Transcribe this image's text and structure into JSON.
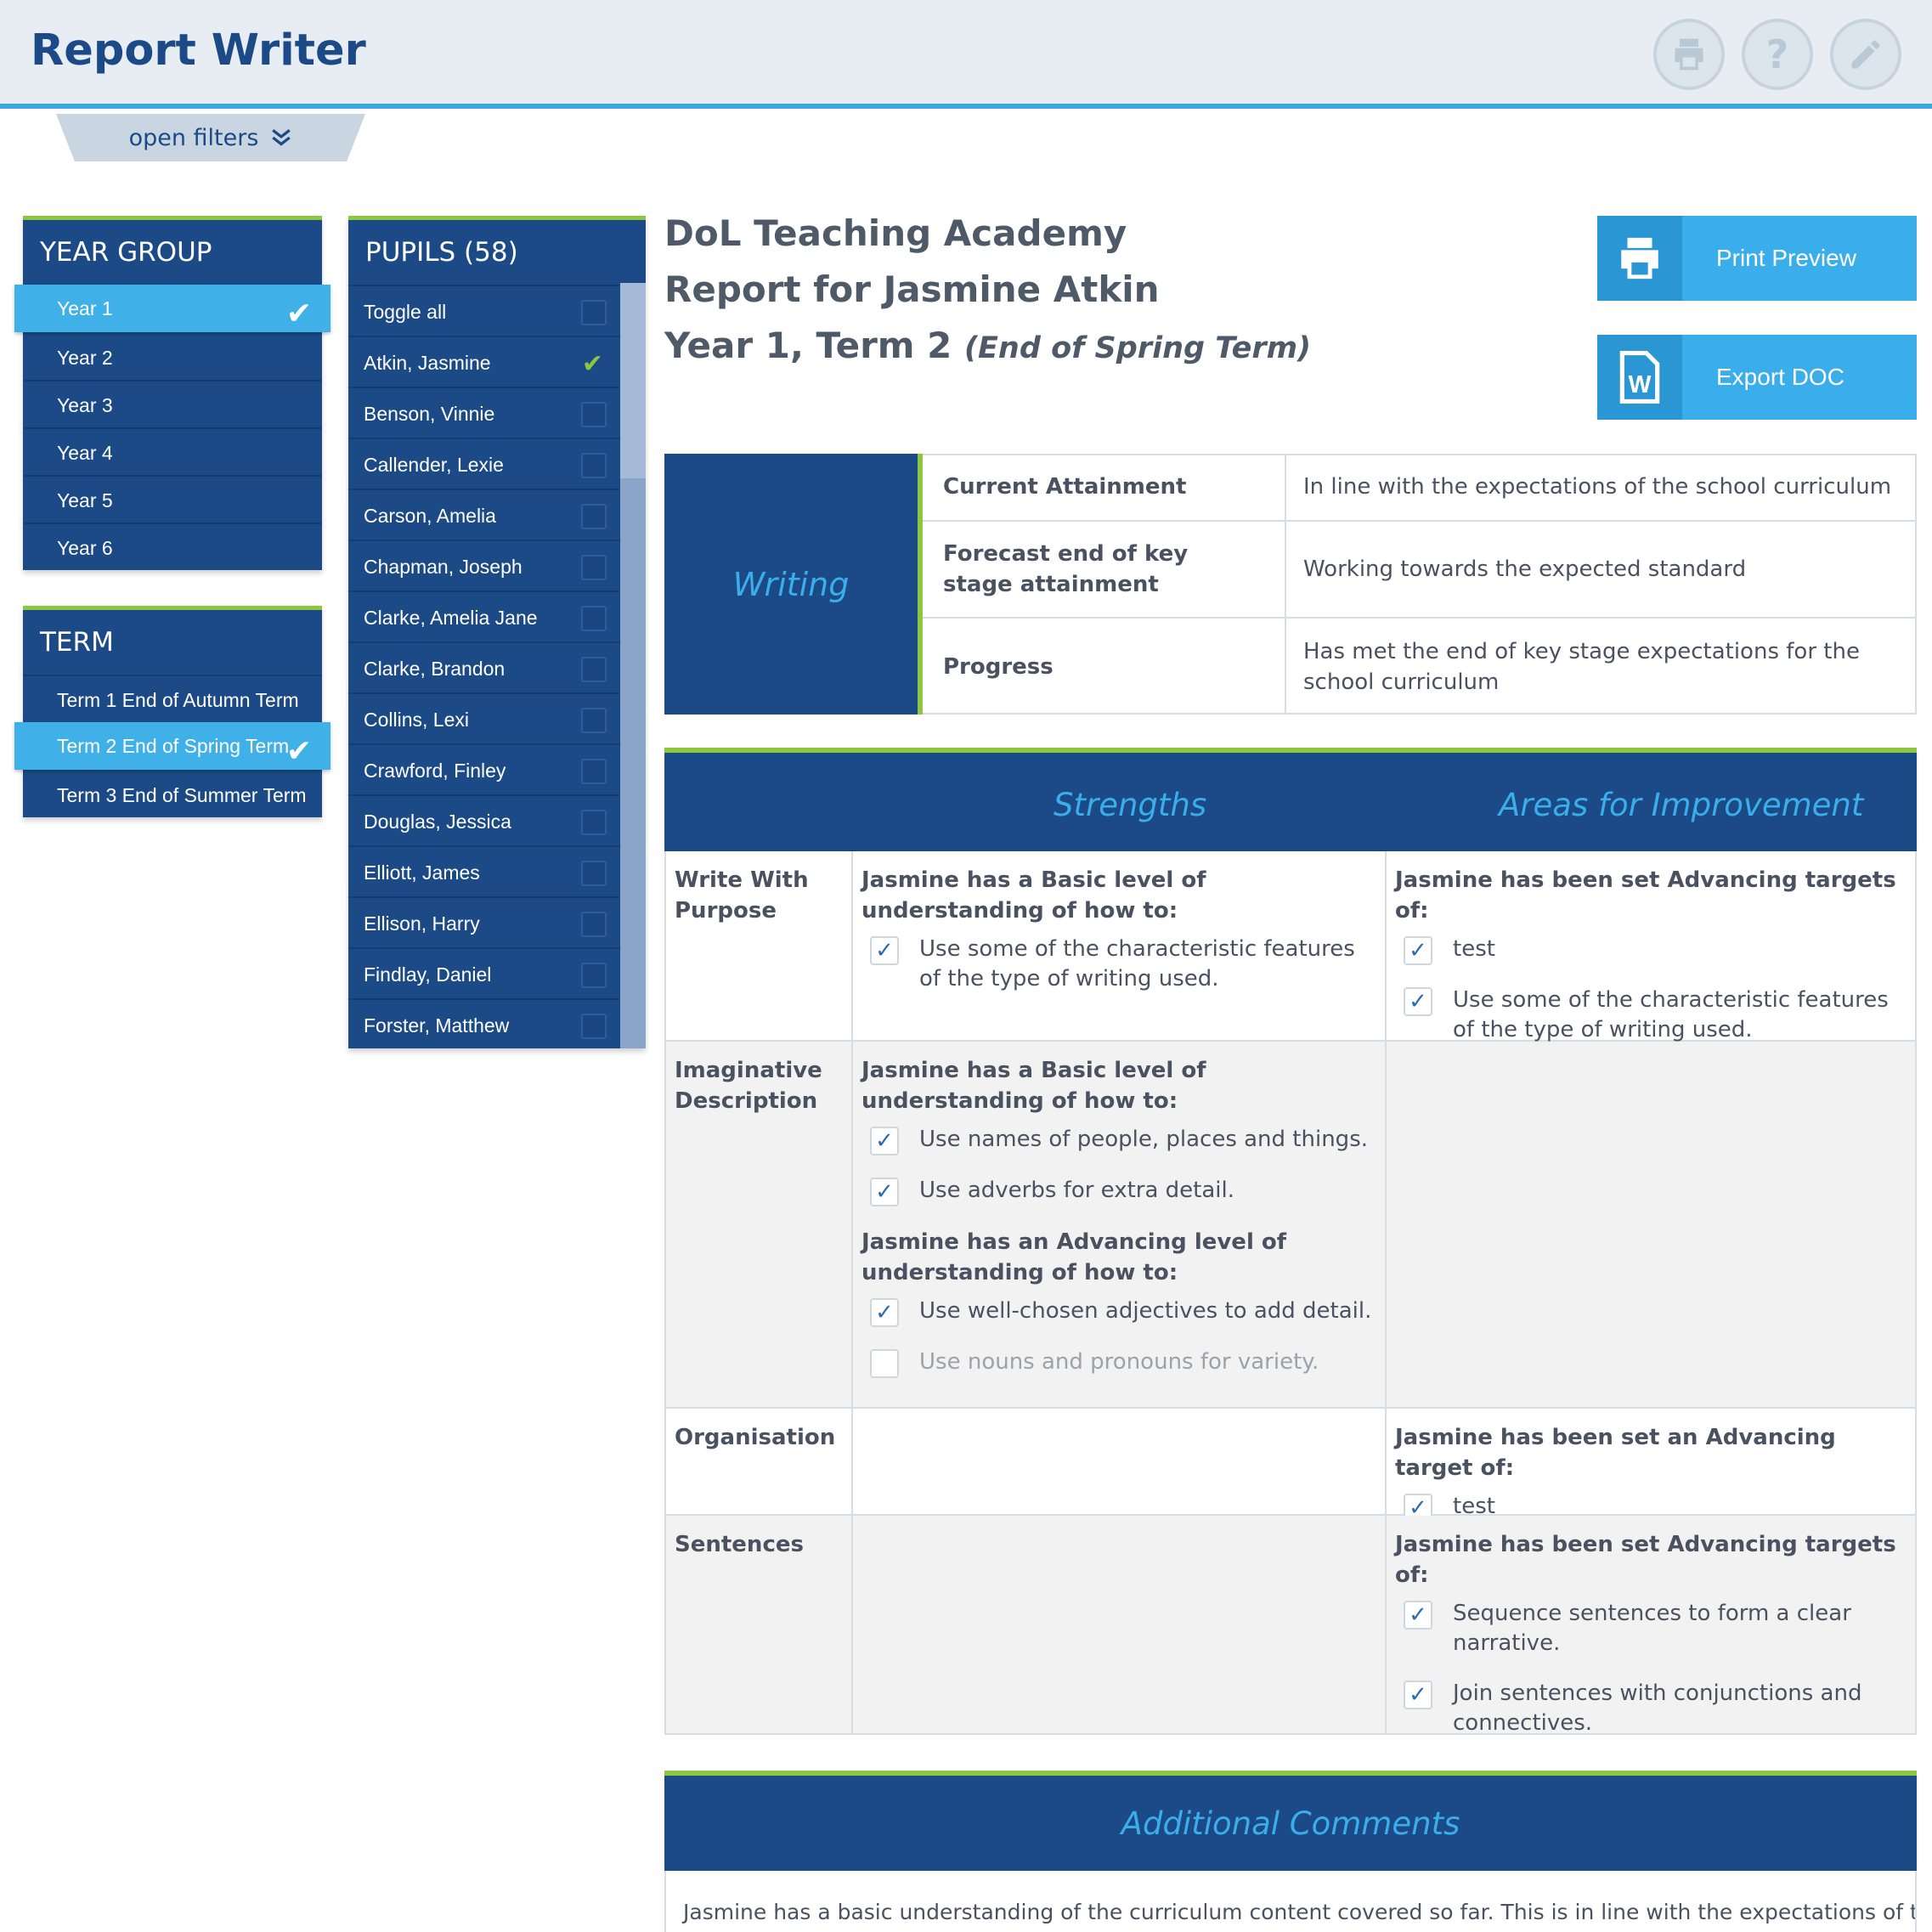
{
  "header": {
    "title": "Report Writer",
    "icons": [
      "print-icon",
      "help-icon",
      "edit-icon"
    ],
    "help_glyph": "?"
  },
  "filters": {
    "label": "open filters"
  },
  "year_group": {
    "title": "YEAR GROUP",
    "items": [
      {
        "label": "Year 1",
        "selected": true
      },
      {
        "label": "Year 2",
        "selected": false
      },
      {
        "label": "Year 3",
        "selected": false
      },
      {
        "label": "Year 4",
        "selected": false
      },
      {
        "label": "Year 5",
        "selected": false
      },
      {
        "label": "Year 6",
        "selected": false
      }
    ]
  },
  "term": {
    "title": "TERM",
    "items": [
      {
        "label": "Term 1 End of Autumn Term",
        "selected": false
      },
      {
        "label": "Term 2 End of Spring Term",
        "selected": true
      },
      {
        "label": "Term 3 End of Summer Term",
        "selected": false
      }
    ]
  },
  "pupils": {
    "title": "PUPILS (58)",
    "items": [
      {
        "label": "Toggle all",
        "checked": false
      },
      {
        "label": "Atkin, Jasmine",
        "checked": true
      },
      {
        "label": "Benson, Vinnie",
        "checked": false
      },
      {
        "label": "Callender, Lexie",
        "checked": false
      },
      {
        "label": "Carson, Amelia",
        "checked": false
      },
      {
        "label": "Chapman, Joseph",
        "checked": false
      },
      {
        "label": "Clarke, Amelia Jane",
        "checked": false
      },
      {
        "label": "Clarke, Brandon",
        "checked": false
      },
      {
        "label": "Collins, Lexi",
        "checked": false
      },
      {
        "label": "Crawford, Finley",
        "checked": false
      },
      {
        "label": "Douglas, Jessica",
        "checked": false
      },
      {
        "label": "Elliott, James",
        "checked": false
      },
      {
        "label": "Ellison, Harry",
        "checked": false
      },
      {
        "label": "Findlay, Daniel",
        "checked": false
      },
      {
        "label": "Forster, Matthew",
        "checked": false
      }
    ]
  },
  "report": {
    "school": "DoL Teaching Academy",
    "title": "Report for Jasmine Atkin",
    "period": "Year 1, Term 2",
    "period_note": "(End of Spring Term)"
  },
  "actions": {
    "print_preview": "Print Preview",
    "export_doc": "Export DOC"
  },
  "writing": {
    "label": "Writing",
    "rows": [
      {
        "key": "Current Attainment",
        "value": "In line with the expectations of the school curriculum"
      },
      {
        "key": "Forecast end of key stage attainment",
        "value": "Working towards the expected standard"
      },
      {
        "key": "Progress",
        "value": "Has met the end of key stage expectations for the school curriculum"
      }
    ]
  },
  "strengths_table": {
    "strengths_title": "Strengths",
    "improvement_title": "Areas for Improvement",
    "rows": [
      {
        "name": "Write With Purpose",
        "strengths": [
          {
            "lead": "Jasmine has a Basic level of understanding of how to:",
            "items": [
              {
                "text": "Use some of the characteristic features of the type of writing used.",
                "checked": true
              }
            ]
          }
        ],
        "improvements": [
          {
            "lead": "Jasmine has been set Advancing targets of:",
            "items": [
              {
                "text": "test",
                "checked": true
              },
              {
                "text": "Use some of the characteristic features of the type of writing used.",
                "checked": true
              }
            ]
          }
        ]
      },
      {
        "name": "Imaginative Description",
        "strengths": [
          {
            "lead": "Jasmine has a Basic level of understanding of how to:",
            "items": [
              {
                "text": "Use names of people, places and things.",
                "checked": true
              },
              {
                "text": "Use adverbs for extra detail.",
                "checked": true
              }
            ]
          },
          {
            "lead": "Jasmine has an Advancing level of understanding of how to:",
            "items": [
              {
                "text": "Use well-chosen adjectives to add detail.",
                "checked": true
              },
              {
                "text": "Use nouns and pronouns for variety.",
                "checked": false
              }
            ]
          }
        ],
        "improvements": []
      },
      {
        "name": "Organisation",
        "strengths": [],
        "improvements": [
          {
            "lead": "Jasmine has been set an Advancing target of:",
            "items": [
              {
                "text": "test",
                "checked": true
              }
            ]
          }
        ]
      },
      {
        "name": "Sentences",
        "strengths": [],
        "improvements": [
          {
            "lead": "Jasmine has been set Advancing targets of:",
            "items": [
              {
                "text": "Sequence sentences to form a clear narrative.",
                "checked": true
              },
              {
                "text": "Join sentences with conjunctions and connectives.",
                "checked": true
              }
            ]
          }
        ]
      }
    ]
  },
  "additional_comments": {
    "title": "Additional Comments",
    "text": "Jasmine has a basic understanding of the curriculum content covered so far. This is in line with the expectations of the"
  },
  "colors": {
    "brand_navy": "#1b4a86",
    "accent_blue": "#3aaeea",
    "accent_green": "#8dc63f"
  }
}
